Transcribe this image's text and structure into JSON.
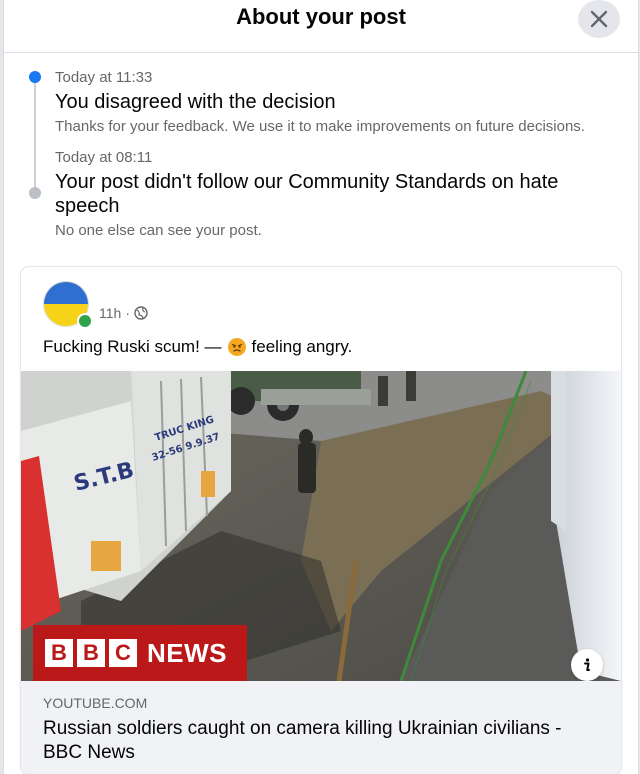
{
  "header": {
    "title": "About your post",
    "close_icon": "close-icon"
  },
  "timeline": {
    "items": [
      {
        "time": "Today at 11:33",
        "title": "You disagreed with the decision",
        "subtitle": "Thanks for your feedback. We use it to make improvements on future decisions.",
        "dot_color": "#1877f2"
      },
      {
        "time": "Today at 08:11",
        "title": "Your post didn't follow our Community Standards on hate speech",
        "subtitle": "No one else can see your post.",
        "dot_color": "#bcc0c4"
      }
    ]
  },
  "post": {
    "avatar_icon": "ukraine-flag-avatar",
    "timestamp": "11h",
    "separator": "·",
    "privacy_icon": "globe-icon",
    "text": "Fucking Ruski scum! —",
    "feeling_icon": "angry-emoji-icon",
    "feeling_text": "feeling angry.",
    "media": {
      "badge_letters": [
        "B",
        "B",
        "C"
      ],
      "badge_word": "NEWS",
      "truck_label": "S.T.B",
      "truck_brand": "TRUC KING",
      "truck_phone": "32-56 9.9.37",
      "info_icon": "info-icon"
    },
    "link": {
      "domain": "YOUTUBE.COM",
      "title": "Russian soldiers caught on camera killing Ukrainian civilians - BBC News"
    }
  },
  "colors": {
    "accent": "#1877f2",
    "bbc_red": "#bb1919",
    "secondary_text": "#65676b"
  }
}
